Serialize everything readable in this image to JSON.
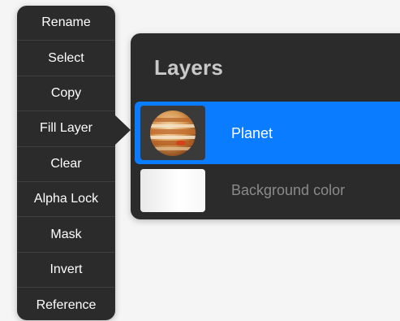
{
  "menu": {
    "items": [
      {
        "label": "Rename"
      },
      {
        "label": "Select"
      },
      {
        "label": "Copy"
      },
      {
        "label": "Fill Layer"
      },
      {
        "label": "Clear"
      },
      {
        "label": "Alpha Lock"
      },
      {
        "label": "Mask"
      },
      {
        "label": "Invert"
      },
      {
        "label": "Reference"
      }
    ]
  },
  "layers_panel": {
    "title": "Layers",
    "layers": [
      {
        "name": "Planet",
        "selected": true,
        "thumbnail": "jupiter-planet-icon"
      },
      {
        "name": "Background color",
        "selected": false,
        "thumbnail": "white-fill"
      }
    ]
  },
  "colors": {
    "menu_background": "#2b2b2b",
    "panel_background": "#2b2b2b",
    "selection_accent": "#0a7cff",
    "page_background": "#f5f5f5"
  }
}
